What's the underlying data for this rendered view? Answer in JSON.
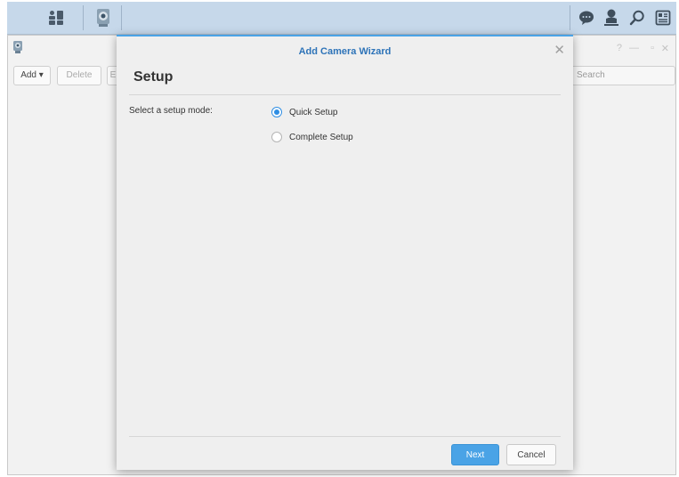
{
  "taskbar": {
    "left_icons": [
      "main-menu-icon",
      "surveillance-camera-app-icon"
    ],
    "right_icons": [
      "chat-icon",
      "user-icon",
      "search-icon",
      "widgets-icon"
    ]
  },
  "app": {
    "window_icon": "camera-app-icon",
    "add_label": "Add ▾",
    "delete_label": "Delete",
    "edit_label_partial": "E",
    "search_placeholder": "Search",
    "help_glyph": "?",
    "minimize_glyph": "—",
    "restore_glyph": "▫",
    "close_glyph": "✕"
  },
  "modal": {
    "title": "Add Camera Wizard",
    "close_glyph": "✕",
    "heading": "Setup",
    "mode_label": "Select a setup mode:",
    "options": [
      {
        "label": "Quick Setup",
        "checked": true
      },
      {
        "label": "Complete Setup",
        "checked": false
      }
    ],
    "next_label": "Next",
    "cancel_label": "Cancel"
  },
  "colors": {
    "accent": "#4aa3e6",
    "title": "#2d73b8",
    "taskbar": "#c6d8ea"
  }
}
